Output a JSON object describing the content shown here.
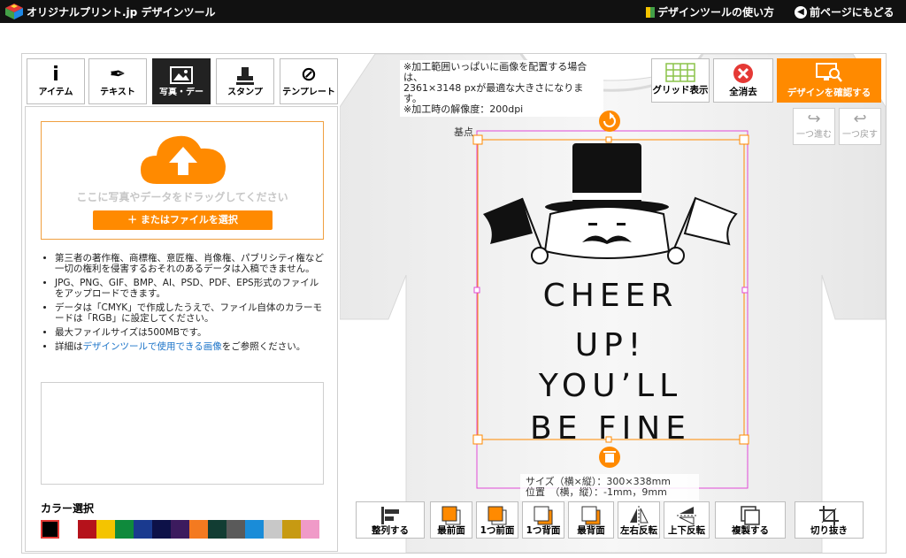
{
  "header": {
    "brand": "オリジナルプリント.jp  デザインツール",
    "help_link": "デザインツールの使い方",
    "back_link": "前ページにもどる"
  },
  "tabs": [
    {
      "label": "アイテム",
      "icon": "info-icon"
    },
    {
      "label": "テキスト",
      "icon": "pen-icon"
    },
    {
      "label": "写真・デー",
      "icon": "image-icon",
      "active": true
    },
    {
      "label": "スタンプ",
      "icon": "stamp-icon"
    },
    {
      "label": "テンプレート",
      "icon": "template-icon"
    }
  ],
  "upload": {
    "drop_text": "ここに写真やデータをドラッグしてください",
    "file_button": "＋ またはファイルを選択"
  },
  "notes": {
    "n1": "第三者の著作権、商標権、意匠権、肖像権、パブリシティ権など一切の権利を侵害するおそれのあるデータは入稿できません。",
    "n2": "JPG、PNG、GIF、BMP、AI、PSD、PDF、EPS形式のファイルをアップロードできます。",
    "n3": "データは「CMYK」で作成したうえで、ファイル自体のカラーモードは「RGB」に設定してください。",
    "n4": "最大ファイルサイズは500MBです。",
    "n5_pre": "詳細は",
    "n5_link": "デザインツールで使用できる画像",
    "n5_post": "をご参照ください。"
  },
  "colors": {
    "label": "カラー選択",
    "swatches": [
      "#000000",
      "#ffffff",
      "#b5121b",
      "#f4c400",
      "#0f8a3c",
      "#1a3a8f",
      "#0d1148",
      "#3c1b5e",
      "#f47a20",
      "#123d33",
      "#5a5a5a",
      "#1a8cd8",
      "#c8c8c8",
      "#c79a12",
      "#f09ac8"
    ],
    "accent": "#ff8a00",
    "selection": "#e04ad6"
  },
  "canvas": {
    "notice_1": "※加工範囲いっぱいに画像を配置する場合は、",
    "notice_2": "2361×3148 pxが最適な大きさになります。",
    "notice_3": "※加工時の解像度：200dpi",
    "kiten": "基点",
    "design_text": [
      "CHEER",
      "UP!",
      "YOU’LL",
      "BE FINE"
    ],
    "size_label": "サイズ（横×縦）：300×338mm",
    "pos_label": "位置　（横，縦）：-1mm，9mm"
  },
  "toolbar": {
    "grid": "グリッド表示",
    "clear": "全消去",
    "confirm": "デザインを確認する",
    "redo": "一つ進む",
    "undo": "一つ戻す"
  },
  "bottom_tools": {
    "align": "整列する",
    "front_most": "最前面",
    "front_one": "1つ前面",
    "back_one": "1つ背面",
    "back_most": "最背面",
    "flip_h": "左右反転",
    "flip_v": "上下反転",
    "duplicate": "複製する",
    "crop": "切り抜き"
  }
}
